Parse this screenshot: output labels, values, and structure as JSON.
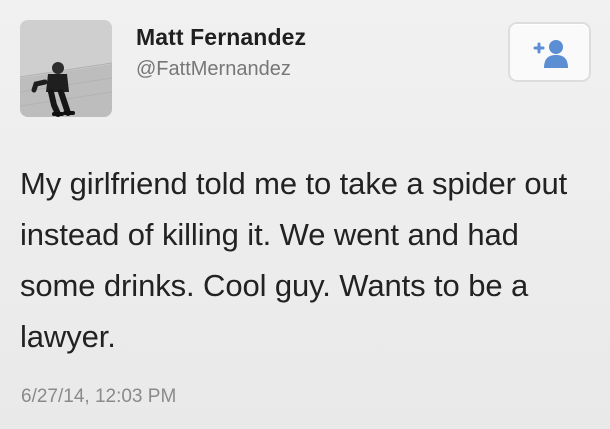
{
  "user": {
    "name": "Matt Fernandez",
    "handle": "@FattMernandez"
  },
  "tweet": {
    "text": "My girlfriend told me to take a spider out instead of killing it. We went and had some drinks. Cool guy. Wants to be a lawyer.",
    "timestamp": "6/27/14, 12:03 PM"
  },
  "icons": {
    "avatar": "profile-photo",
    "follow": "add-user-icon"
  },
  "colors": {
    "accent": "#5b8ed3",
    "name": "#1f1f1f",
    "secondary": "#8a8a8a"
  }
}
